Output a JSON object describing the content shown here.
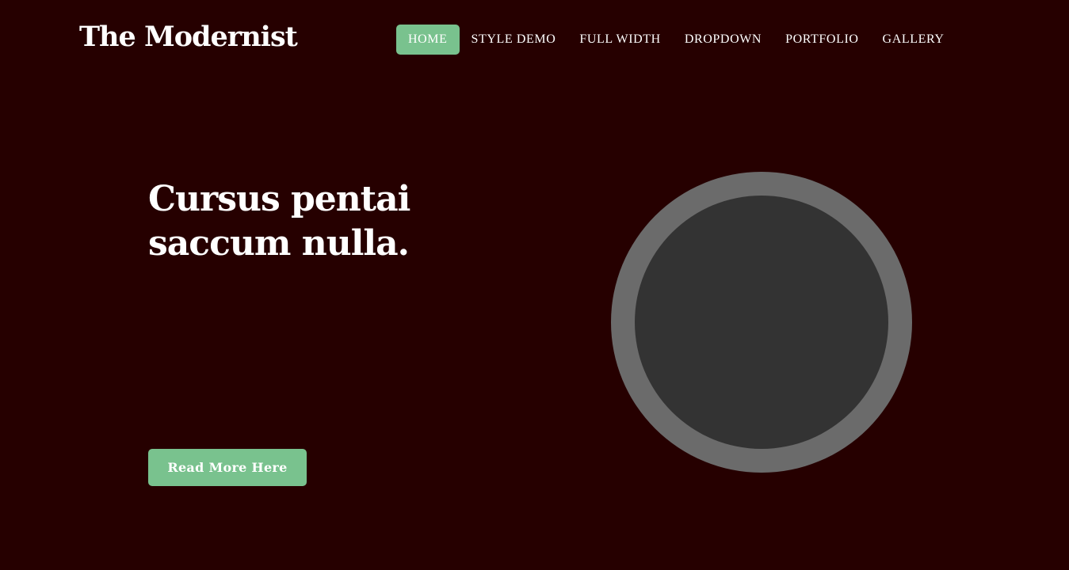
{
  "site": {
    "title": "The Modernist"
  },
  "nav": {
    "items": [
      {
        "label": "HOME",
        "active": true
      },
      {
        "label": "STYLE DEMO",
        "active": false
      },
      {
        "label": "FULL WIDTH",
        "active": false
      },
      {
        "label": "DROPDOWN",
        "active": false
      },
      {
        "label": "PORTFOLIO",
        "active": false
      },
      {
        "label": "GALLERY",
        "active": false
      }
    ]
  },
  "hero": {
    "heading_line1": "Cursus pentai",
    "heading_line2": "saccum nulla.",
    "button_label": "Read More Here",
    "image_icon": "circle-image-placeholder"
  },
  "colors": {
    "background": "#260000",
    "accent": "#79c28e",
    "text": "#ffffff",
    "image_ring": "#6b6b6b",
    "image_fill": "#333333"
  }
}
